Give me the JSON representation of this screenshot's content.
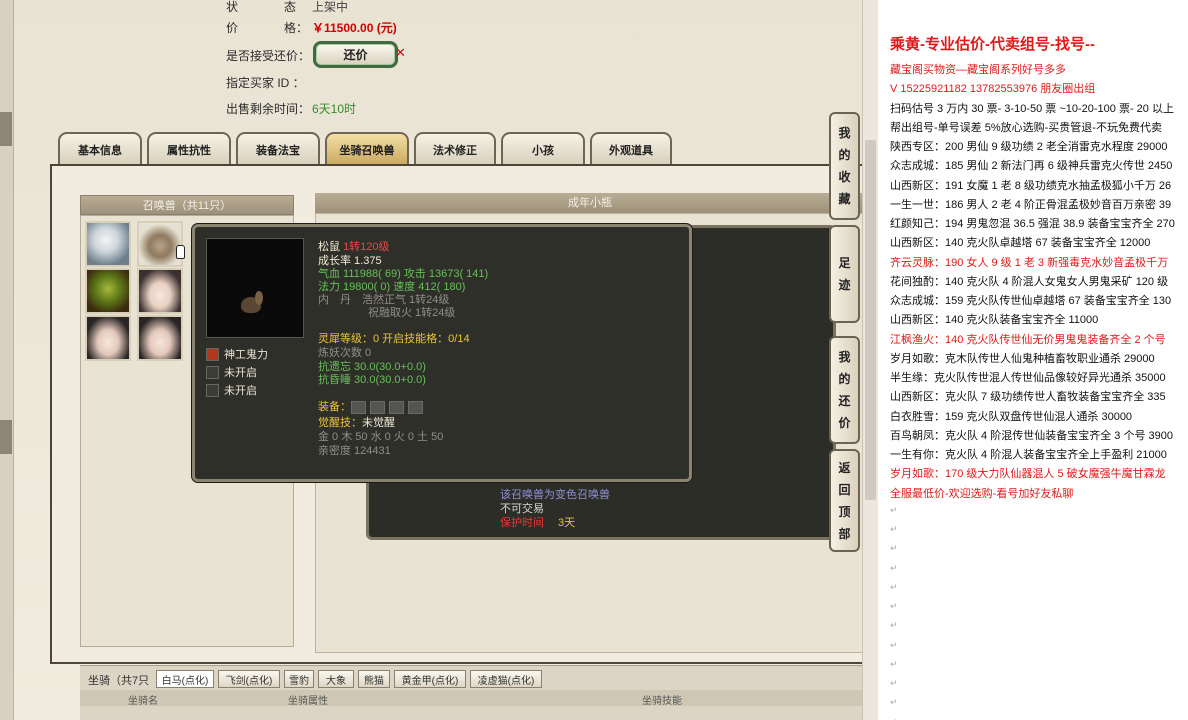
{
  "info": {
    "status_label": "状",
    "status_label2": "态",
    "status_value": "上架中",
    "price_label": "价",
    "price_label2": "格：",
    "price_value": "￥11500.00 (元)",
    "bargain_label": "是否接受还价：",
    "bargain_button": "还价",
    "buyer_label": "指定买家 ID ：",
    "remaining_label": "出售剩余时间：",
    "remaining_value": "6天10时"
  },
  "tabs": [
    "基本信息",
    "属性抗性",
    "装备法宝",
    "坐骑召唤兽",
    "法术修正",
    "小孩",
    "外观道具"
  ],
  "active_tab": "坐骑召唤兽",
  "summons": {
    "title": "召唤兽（共11只）",
    "detail_title": "成年小瓶"
  },
  "tooltip": {
    "name": "松鼠",
    "level": "1转120级",
    "growth": "成长率 1.375",
    "hp": "气血 111988( 69)",
    "attack": "攻击 13673( 141)",
    "mana": "法力 19800( 0)",
    "speed": "速度 412( 180)",
    "neidan_label": "内　丹",
    "neidan1": "浩然正气 1转24级",
    "neidan2": "祝融取火 1转24级",
    "lingxi": "灵犀等级：0 开启技能格：0/14",
    "lianyao": "炼妖次数 0",
    "resist_forget": "抗遗忘 30.0(30.0+0.0)",
    "resist_sleep": "抗昏睡 30.0(30.0+0.0)",
    "equip_label": "装备：",
    "awaken_label": "觉醒技：",
    "awaken_value": "未觉醒",
    "elements": "金 0 木 50 水 0 火 0 土 50",
    "intimacy": "亲密度 124431",
    "skills": [
      {
        "name": "神工鬼力",
        "icon": "skill-icon"
      },
      {
        "name": "未开启",
        "icon": "locked-icon"
      },
      {
        "name": "未开启",
        "icon": "locked-icon"
      }
    ]
  },
  "behind_panel": {
    "line1": "该召唤兽为变色召唤兽",
    "line2": "不可交易",
    "line3_label": "保护时间",
    "line3_value": "3天"
  },
  "sidebar": [
    {
      "label": "我的收藏"
    },
    {
      "label": "足迹"
    },
    {
      "label": "我的还价"
    },
    {
      "label": "返回顶部"
    }
  ],
  "mounts": {
    "label": "坐骑（共7只",
    "tabs": [
      "白马(点化)",
      "飞剑(点化)",
      "雪豹",
      "大象",
      "熊猫",
      "黄金甲(点化)",
      "凌虚猫(点化)"
    ],
    "header": [
      "坐骑名",
      "坐骑属性",
      "坐骑技能"
    ]
  },
  "right": {
    "title": "乘黄-专业估价-代卖组号-找号--",
    "lines": [
      {
        "text": "藏宝阁买物资—藏宝阁系列好号多多",
        "red": true
      },
      {
        "text": "V 15225921182   13782553976 朋友圈出组",
        "red": true
      },
      {
        "text": "扫码估号 3 万内 30 票- 3-10-50 票  ~10-20-100 票- 20 以上",
        "red": false
      },
      {
        "text": "帮出组号-单号误差 5%放心选购-买贵管退-不玩免费代卖",
        "red": false
      },
      {
        "text": "陕西专区：200 男仙 9 级功绩 2 老全消雷克水程度 29000",
        "red": false
      },
      {
        "text": "众志成城：185 男仙 2 新法门再 6 级神兵雷克火传世 2450",
        "red": false
      },
      {
        "text": "山西新区：191 女魔 1 老 8 级功绩克水抽孟极狐小千万 26",
        "red": false
      },
      {
        "text": "一生一世：186 男人 2 老 4 阶正骨混孟极妙音百万亲密 39",
        "red": false
      },
      {
        "text": "红颜知己：194 男鬼忽混 36.5 强混 38.9 装备宝宝齐全 270",
        "red": false
      },
      {
        "text": "山西新区：140 克火队卓越塔 67 装备宝宝齐全 12000",
        "red": false
      },
      {
        "text": "齐云灵脉：190 女人 9 级 1 老 3 新强毒克水妙音孟极千万",
        "red": true
      },
      {
        "text": "花间独酌：140 克火队 4 阶混人女鬼女人男鬼采矿 120 级",
        "red": false
      },
      {
        "text": "众志成城：159 克火队传世仙卓越塔 67 装备宝宝齐全 130",
        "red": false
      },
      {
        "text": "山西新区：140 克火队装备宝宝齐全 11000",
        "red": false
      },
      {
        "text": "江枫渔火：140 克火队传世仙无价男鬼鬼装备齐全 2 个号",
        "red": true
      },
      {
        "text": "岁月如歌：克木队传世人仙鬼种植畜牧职业通杀 29000",
        "red": false
      },
      {
        "text": "半生缘：克火队传世混人传世仙品像较好异光通杀 35000",
        "red": false
      },
      {
        "text": "山西新区：克火队 7 级功绩传世人畜牧装备宝宝齐全 335",
        "red": false
      },
      {
        "text": "白衣胜雪：159 克火队双盘传世仙混人通杀 30000",
        "red": false
      },
      {
        "text": "百鸟朝凤：克火队 4 阶混传世仙装备宝宝齐全 3 个号 3900",
        "red": false
      },
      {
        "text": "一生有你：克火队 4 阶混人装备宝宝齐全上手盈利 21000",
        "red": false
      },
      {
        "text": "岁月如歌：170 级大力队仙器混人 5 破女魔强牛魔甘霖龙",
        "red": true
      },
      {
        "text": "全服最低价-欢迎选购-看号加好友私聊",
        "red": true
      }
    ],
    "para_mark": "↵"
  }
}
